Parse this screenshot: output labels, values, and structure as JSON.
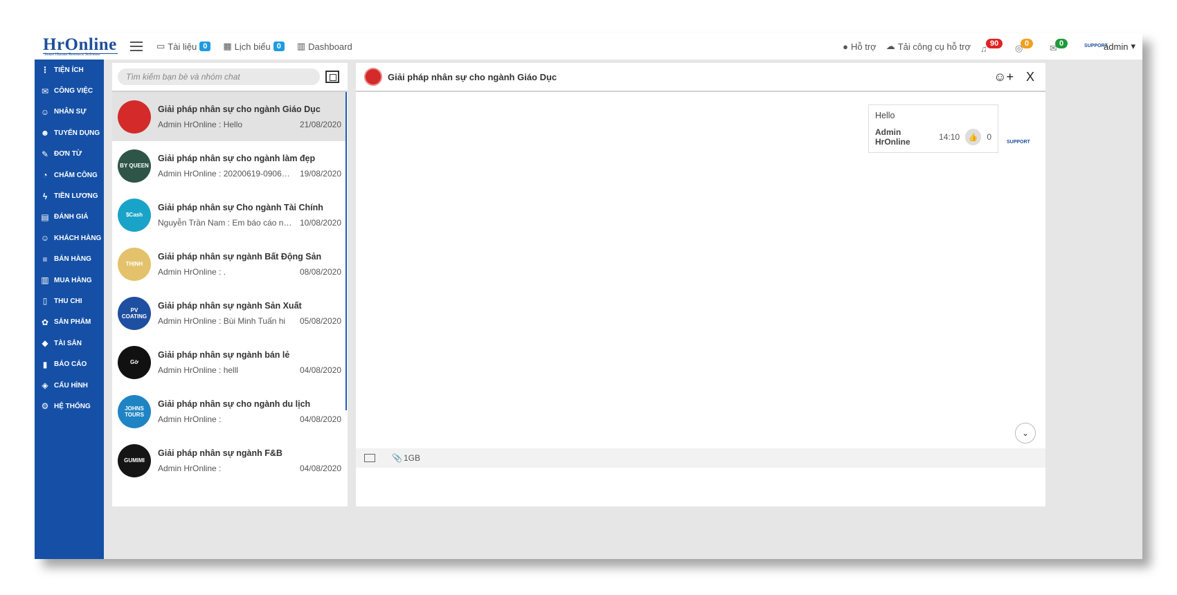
{
  "header": {
    "logo_text": "HrOnline",
    "logo_sub": "Smart Human Resource Software",
    "nav": [
      {
        "label": "Tài liệu",
        "badge": "0",
        "icon": "folder-icon"
      },
      {
        "label": "Lịch biểu",
        "badge": "0",
        "icon": "calendar-icon"
      },
      {
        "label": "Dashboard",
        "icon": "bar-chart-icon"
      }
    ],
    "support_label": "Hỗ trợ",
    "download_label": "Tải công cụ hỗ trợ",
    "notifications": [
      {
        "icon": "bell-icon",
        "count": "90",
        "color": "#e02323"
      },
      {
        "icon": "globe-icon",
        "count": "0",
        "color": "#f0a020"
      },
      {
        "icon": "mail-icon",
        "count": "0",
        "color": "#1f9a3a"
      }
    ],
    "avatar_text": "SUPPORT",
    "user_name": "admin"
  },
  "sidebar": {
    "items": [
      {
        "label": "TIỆN ÍCH",
        "icon": "more-vertical-icon",
        "glyph": "⋮"
      },
      {
        "label": "CÔNG VIỆC",
        "icon": "inbox-icon",
        "glyph": "✉"
      },
      {
        "label": "NHÂN SỰ",
        "icon": "user-icon",
        "glyph": "☺"
      },
      {
        "label": "TUYỂN DỤNG",
        "icon": "user-plus-icon",
        "glyph": "☻"
      },
      {
        "label": "ĐƠN TỪ",
        "icon": "edit-icon",
        "glyph": "✎"
      },
      {
        "label": "CHẤM CÔNG",
        "icon": "speedometer-icon",
        "glyph": "◔"
      },
      {
        "label": "TIỀN LƯƠNG",
        "icon": "bolt-icon",
        "glyph": "ϟ"
      },
      {
        "label": "ĐÁNH GIÁ",
        "icon": "book-icon",
        "glyph": "▤"
      },
      {
        "label": "KHÁCH HÀNG",
        "icon": "customer-icon",
        "glyph": "☺"
      },
      {
        "label": "BÁN HÀNG",
        "icon": "menu-icon",
        "glyph": "≡"
      },
      {
        "label": "MUA HÀNG",
        "icon": "map-icon",
        "glyph": "▥"
      },
      {
        "label": "THU CHI",
        "icon": "file-icon",
        "glyph": "▯"
      },
      {
        "label": "SẢN PHẨM",
        "icon": "tag-icon",
        "glyph": "✿"
      },
      {
        "label": "TÀI SẢN",
        "icon": "diamond-icon",
        "glyph": "◆"
      },
      {
        "label": "BÁO CÁO",
        "icon": "report-chart-icon",
        "glyph": "▮"
      },
      {
        "label": "CẤU HÌNH",
        "icon": "layers-icon",
        "glyph": "◈"
      },
      {
        "label": "HỆ THỐNG",
        "icon": "gear-icon",
        "glyph": "⚙"
      }
    ]
  },
  "chatlist": {
    "search_placeholder": "Tìm kiếm bạn bè và nhóm chat",
    "conversations": [
      {
        "name": "Giải pháp nhân sự cho ngành Giáo Dục",
        "preview": "Admin HrOnline : Hello",
        "date": "21/08/2020",
        "color": "#d42a2a",
        "logo": ""
      },
      {
        "name": "Giải pháp nhân sự cho ngành làm đẹp",
        "preview": "Admin HrOnline : 20200619-09063...",
        "date": "19/08/2020",
        "color": "#2f5548",
        "logo": "BY QUEEN"
      },
      {
        "name": "Giải pháp nhân sự Cho ngành Tài Chính",
        "preview": "Nguyễn Trần Nam : Em báo cáo nh...",
        "date": "10/08/2020",
        "color": "#1aa3c9",
        "logo": "$Cash"
      },
      {
        "name": "Giải pháp nhân sự ngành Bất Động Sản",
        "preview": "Admin HrOnline : .",
        "date": "08/08/2020",
        "color": "#e3c26b",
        "logo": "THỊNH"
      },
      {
        "name": "Giải pháp nhân sự ngành Sản Xuất",
        "preview": "Admin HrOnline : Bùi Minh Tuấn hi",
        "date": "05/08/2020",
        "color": "#1f4fa0",
        "logo": "PV COATING"
      },
      {
        "name": "Giải pháp nhân sự ngành bán lẻ",
        "preview": "Admin HrOnline : helll",
        "date": "04/08/2020",
        "color": "#111111",
        "logo": "Gờ"
      },
      {
        "name": "Giải pháp nhân sự cho ngành du lịch",
        "preview": "Admin HrOnline :",
        "date": "04/08/2020",
        "color": "#1f84c4",
        "logo": "JOHNS TOURS"
      },
      {
        "name": "Giải pháp nhân sự ngành F&B",
        "preview": "Admin HrOnline :",
        "date": "04/08/2020",
        "color": "#151515",
        "logo": "GUMIMI"
      }
    ]
  },
  "chat": {
    "title": "Giải pháp nhân sự cho ngành Giáo Dục",
    "message": {
      "text": "Hello",
      "author": "Admin HrOnline",
      "time": "14:10",
      "likes": "0"
    },
    "avatar_text": "SUPPORT",
    "attach_label": "1GB"
  }
}
